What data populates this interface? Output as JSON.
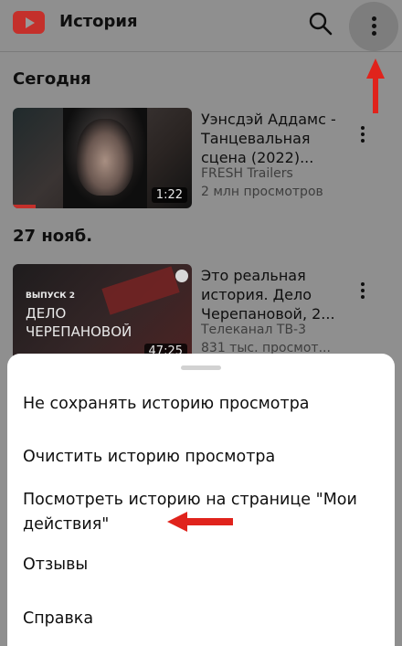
{
  "header": {
    "title": "История",
    "logo_icon": "youtube-logo",
    "search_icon": "search-icon",
    "more_icon": "more-vertical-icon"
  },
  "sections": {
    "today": "Сегодня",
    "nov27": "27 нояб."
  },
  "videos": [
    {
      "title": "Уэнсдэй Аддамс - Танцевальная сцена (2022)...",
      "channel": "FRESH Trailers",
      "views": "2 млн просмотров",
      "duration": "1:22",
      "watched_fraction": 0.13
    },
    {
      "title": "Это реальная история. Дело Черепановой, 2...",
      "channel": "Телеканал ТВ-3",
      "views": "831 тыс. просмот...",
      "duration": "47:25",
      "thumb_caption_small": "ВЫПУСК 2",
      "thumb_caption_big": "ДЕЛО ЧЕРЕПАНОВОЙ",
      "watched_fraction": 0
    }
  ],
  "menu": {
    "items": [
      "Не сохранять историю просмотра",
      "Очистить историю просмотра",
      "Посмотреть историю на странице \"Мои действия\"",
      "Отзывы",
      "Справка"
    ]
  },
  "colors": {
    "accent": "#c4302b",
    "annotation_arrow": "#e0231c",
    "sheet_background": "#ffffff",
    "dimmed_background": "#8f8f8f"
  }
}
